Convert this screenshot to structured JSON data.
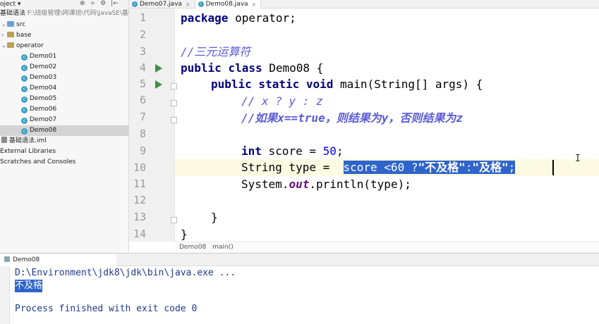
{
  "project": {
    "header_label": "oject",
    "header_chevron": "▾",
    "tool_icons": [
      "⊕",
      "÷",
      "⚙",
      "|←"
    ],
    "module_name": "基础语法",
    "module_path": "F:\\班级管理\\网课班\\代码\\JavaSE\\基础",
    "tree": [
      {
        "label": "src",
        "kind": "folder-src",
        "level": 1,
        "expanded": true
      },
      {
        "label": "base",
        "kind": "folder",
        "level": 1,
        "expanded": false
      },
      {
        "label": "operator",
        "kind": "folder",
        "level": 1,
        "expanded": true
      },
      {
        "label": "Demo01",
        "kind": "class",
        "level": 2
      },
      {
        "label": "Demo02",
        "kind": "class",
        "level": 2
      },
      {
        "label": "Demo03",
        "kind": "class",
        "level": 2
      },
      {
        "label": "Demo04",
        "kind": "class",
        "level": 2
      },
      {
        "label": "Demo05",
        "kind": "class",
        "level": 2
      },
      {
        "label": "Demo06",
        "kind": "class",
        "level": 2
      },
      {
        "label": "Demo07",
        "kind": "class",
        "level": 2
      },
      {
        "label": "Demo08",
        "kind": "class",
        "level": 2,
        "selected": true
      },
      {
        "label": "基础语法.iml",
        "kind": "iml",
        "level": 1
      },
      {
        "label": "External Libraries",
        "kind": "plain",
        "level": 0
      },
      {
        "label": "Scratches and Consoles",
        "kind": "plain",
        "level": 0
      }
    ]
  },
  "tabs": [
    {
      "label": "Demo07.java",
      "active": false
    },
    {
      "label": "Demo08.java",
      "active": true
    }
  ],
  "tab_close": "×",
  "line_numbers": [
    "1",
    "2",
    "3",
    "4",
    "5",
    "6",
    "7",
    "8",
    "9",
    "10",
    "11",
    "12",
    "13",
    "14"
  ],
  "code": {
    "l1_kw": "package",
    "l1_rest": " operator;",
    "l3_comment": "//三元运算符",
    "l4_kw": "public class",
    "l4_rest": " Demo08 {",
    "l5_kw": "public static void",
    "l5_rest": " main(String[] args) {",
    "l6_comment": "// x ? y : z",
    "l7_comment": "//如果x==true，则结果为y，否则结果为z",
    "l9_kw": "int",
    "l9_mid": " score = ",
    "l9_num": "50",
    "l9_end": ";",
    "l10_pre": "String type =  ",
    "l10_sel_a": "score <60 ?",
    "l10_sel_s1": "\"不及格\"",
    "l10_sel_b": ":",
    "l10_sel_s2": "\"及格\"",
    "l10_sel_c": ";",
    "l11_a": "System.",
    "l11_field": "out",
    "l11_b": ".println(type);",
    "l13": "}",
    "l14": "}"
  },
  "cursor_glyph": "I",
  "breadcrumb": [
    "Demo08",
    "main()"
  ],
  "run": {
    "tab_label": "Demo08",
    "command": "D:\\Environment\\jdk8\\jdk\\bin\\java.exe ...",
    "output": "不及格",
    "finished": "Process finished with exit code 0"
  }
}
